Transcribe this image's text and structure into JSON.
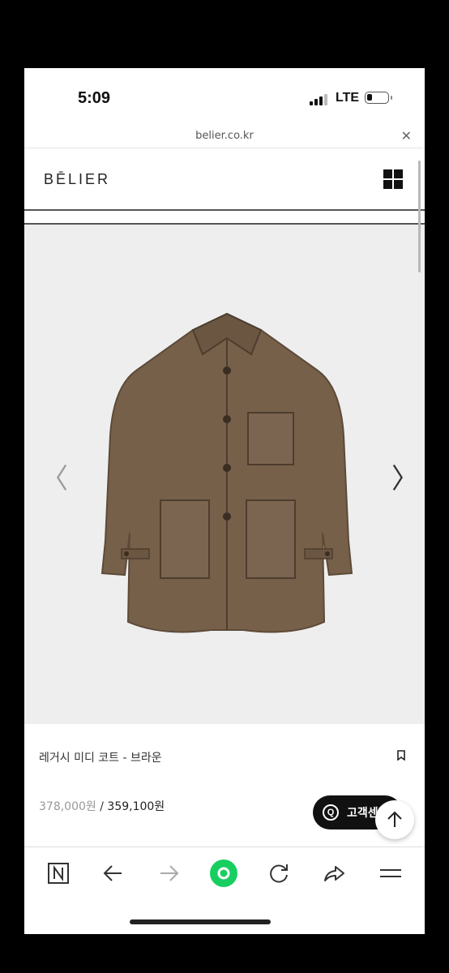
{
  "status_bar": {
    "time": "5:09",
    "network": "LTE",
    "battery_level": 0.2
  },
  "browser": {
    "url": "belier.co.kr",
    "close_icon": "close-icon"
  },
  "site": {
    "logo": "BĒLIER",
    "menu_icon": "grid-menu-icon"
  },
  "product": {
    "name": "레거시 미디 코트 - 브라운",
    "original_price": "378,000원",
    "separator": " / ",
    "sale_price": "359,100원",
    "image_bg": "#eeeeef",
    "coat_color": "#76604a"
  },
  "customer_service": {
    "label": "고객센터"
  },
  "bottom_nav": {
    "items": [
      "naver-home-icon",
      "back-icon",
      "forward-icon",
      "green-dot-icon",
      "refresh-icon",
      "share-icon",
      "menu-icon"
    ]
  }
}
